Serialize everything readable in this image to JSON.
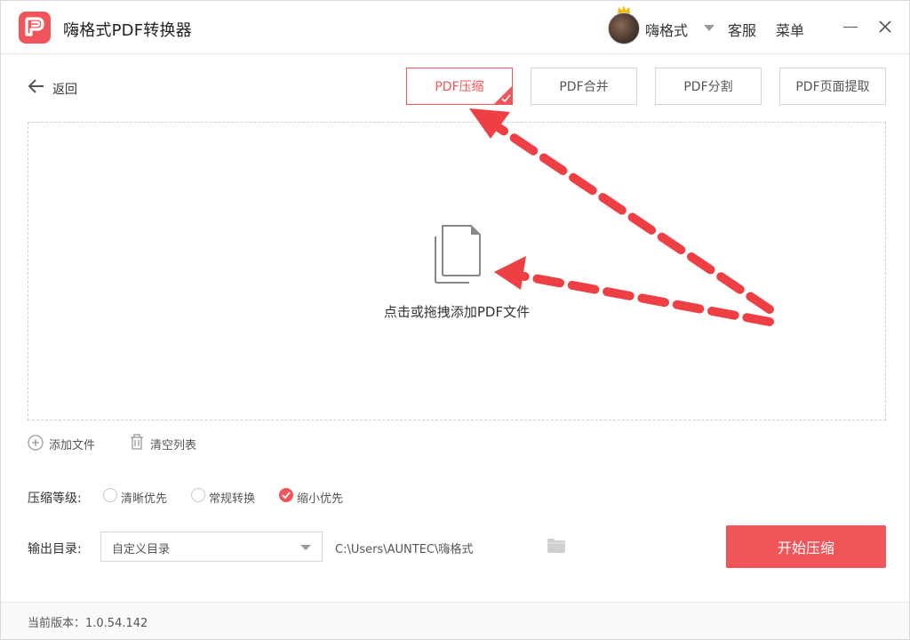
{
  "app": {
    "title": "嗨格式PDF转换器"
  },
  "header": {
    "username": "嗨格式",
    "service": "客服",
    "menu": "菜单"
  },
  "toolbar": {
    "back_label": "返回",
    "tools": [
      {
        "label": "PDF压缩",
        "active": true
      },
      {
        "label": "PDF合并",
        "active": false
      },
      {
        "label": "PDF分割",
        "active": false
      },
      {
        "label": "PDF页面提取",
        "active": false
      }
    ]
  },
  "dropzone": {
    "label": "点击或拖拽添加PDF文件"
  },
  "file_actions": {
    "add_label": "添加文件",
    "clear_label": "清空列表"
  },
  "compression": {
    "label": "压缩等级:",
    "options": [
      {
        "label": "清晰优先",
        "checked": false
      },
      {
        "label": "常规转换",
        "checked": false
      },
      {
        "label": "缩小优先",
        "checked": true
      }
    ]
  },
  "output": {
    "label": "输出目录:",
    "select_value": "自定义目录",
    "path": "C:\\Users\\AUNTEC\\嗨格式"
  },
  "start_button": "开始压缩",
  "footer": {
    "version": "当前版本：1.0.54.142"
  },
  "colors": {
    "accent": "#f0555a",
    "arrow": "#ee3f45"
  },
  "icons": [
    "app-logo-icon",
    "crown-icon",
    "back-arrow-icon",
    "check-icon",
    "file-icon",
    "add-circle-icon",
    "trash-icon",
    "folder-icon",
    "close-icon"
  ]
}
